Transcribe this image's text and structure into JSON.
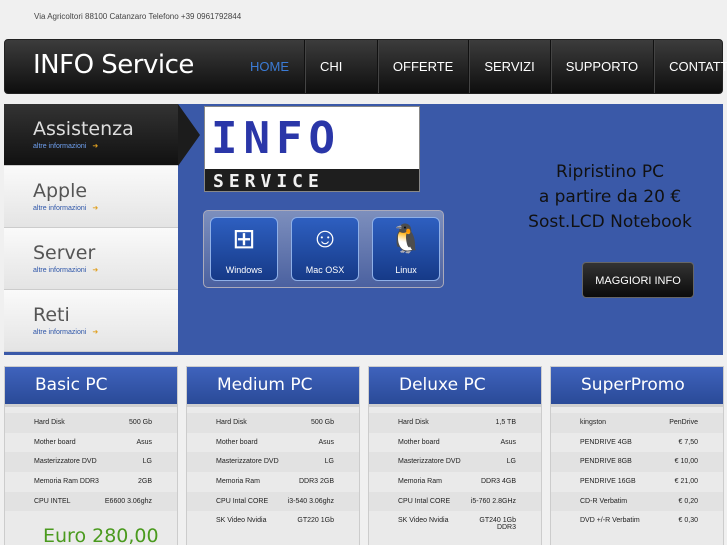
{
  "header": {
    "address": "Via Agricoltori 88100 Catanzaro Telefono +39 0961792844",
    "brand": "INFO Service",
    "nav": [
      "HOME",
      "CHI SIAMO",
      "OFFERTE",
      "SERVIZI",
      "SUPPORTO",
      "CONTATTI"
    ]
  },
  "slider": {
    "tabs": [
      {
        "title": "Assistenza",
        "more": "altre informazioni"
      },
      {
        "title": "Apple",
        "more": "altre informazioni"
      },
      {
        "title": "Server",
        "more": "altre informazioni"
      },
      {
        "title": "Reti",
        "more": "altre informazioni"
      }
    ],
    "logo": {
      "letters": "INFO",
      "sub": "SERVICE"
    },
    "os": [
      {
        "label": "Windows",
        "glyph": "⊞"
      },
      {
        "label": "Mac OSX",
        "glyph": "☺"
      },
      {
        "label": "Linux",
        "glyph": "🐧"
      }
    ],
    "promo_lines": [
      "Ripristino PC",
      "a partire da 20 €",
      "Sost.LCD Notebook"
    ],
    "promo_button": "MAGGIORI INFO"
  },
  "cards": [
    {
      "title": "Basic PC",
      "price": "Euro 280,00",
      "rows": [
        {
          "label": "Hard Disk",
          "value": "500 Gb"
        },
        {
          "label": "Mother board",
          "value": "Asus"
        },
        {
          "label": "Masterizzatore DVD",
          "value": "LG"
        },
        {
          "label": "Memoria Ram DDR3",
          "value": "2GB"
        },
        {
          "label": "CPU INTEL",
          "value": "E6600 3.06ghz"
        }
      ]
    },
    {
      "title": "Medium PC",
      "price": "",
      "rows": [
        {
          "label": "Hard Disk",
          "value": "500 Gb"
        },
        {
          "label": "Mother board",
          "value": "Asus"
        },
        {
          "label": "Masterizzatore DVD",
          "value": "LG"
        },
        {
          "label": "Memoria Ram",
          "value": "DDR3 2GB"
        },
        {
          "label": "CPU Intal CORE",
          "value": "i3-540 3.06ghz"
        },
        {
          "label": "SK Video Nvidia",
          "value": "GT220 1Gb"
        }
      ]
    },
    {
      "title": "Deluxe PC",
      "price": "",
      "rows": [
        {
          "label": "Hard Disk",
          "value": "1,5 TB"
        },
        {
          "label": "Mother board",
          "value": "Asus"
        },
        {
          "label": "Masterizzatore DVD",
          "value": "LG"
        },
        {
          "label": "Memoria Ram",
          "value": "DDR3 4GB"
        },
        {
          "label": "CPU Intal CORE",
          "value": "i5-760 2.8GHz"
        },
        {
          "label": "SK Video Nvidia",
          "value": "GT240 1Gb DDR3"
        }
      ]
    },
    {
      "title": "SuperPromo",
      "price": "",
      "rows": [
        {
          "label": "kingston",
          "value": "PenDrive"
        },
        {
          "label": "PENDRIVE 4GB",
          "value": "€ 7,50"
        },
        {
          "label": "PENDRIVE 8GB",
          "value": "€ 10,00"
        },
        {
          "label": "PENDRIVE 16GB",
          "value": "€ 21,00"
        },
        {
          "label": "CD-R Verbatim",
          "value": "€ 0,20"
        },
        {
          "label": "DVD +/-R Verbatim",
          "value": "€ 0,30"
        }
      ]
    }
  ]
}
